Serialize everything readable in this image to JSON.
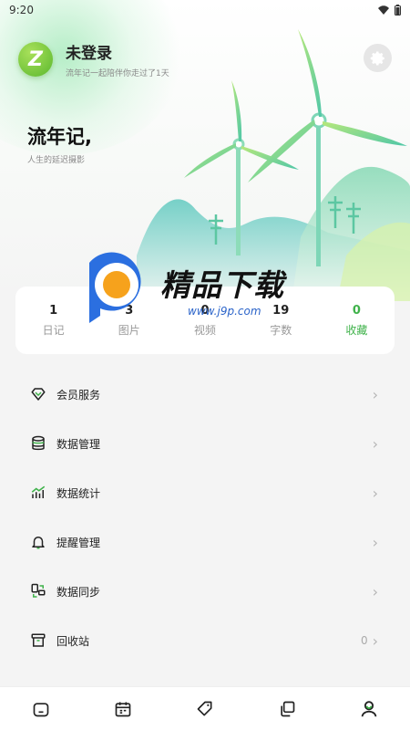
{
  "status_bar": {
    "time": "9:20"
  },
  "profile": {
    "name": "未登录",
    "subtitle": "流年记一起陪伴你走过了1天",
    "avatar_letter": "Z"
  },
  "slogan": {
    "title": "流年记,",
    "subtitle": "人生的延迟摄影"
  },
  "stats": [
    {
      "value": "1",
      "label": "日记"
    },
    {
      "value": "3",
      "label": "图片"
    },
    {
      "value": "0",
      "label": "视频"
    },
    {
      "value": "19",
      "label": "字数"
    },
    {
      "value": "0",
      "label": "收藏"
    }
  ],
  "watermark": {
    "title": "精品下载",
    "url": "www.j9p.com"
  },
  "menu": [
    {
      "label": "会员服务",
      "icon": "diamond-icon"
    },
    {
      "label": "数据管理",
      "icon": "database-icon"
    },
    {
      "label": "数据统计",
      "icon": "chart-icon"
    },
    {
      "label": "提醒管理",
      "icon": "bell-icon"
    },
    {
      "label": "数据同步",
      "icon": "sync-icon"
    },
    {
      "label": "回收站",
      "icon": "trash-box-icon",
      "count": "0"
    }
  ],
  "bottom_nav": [
    {
      "icon": "home-icon"
    },
    {
      "icon": "calendar-icon"
    },
    {
      "icon": "tag-icon"
    },
    {
      "icon": "copy-icon"
    },
    {
      "icon": "profile-icon",
      "active": true
    }
  ],
  "colors": {
    "accent": "#3fb24a",
    "avatar": "#6cc23a",
    "background": "#f4f4f4"
  }
}
